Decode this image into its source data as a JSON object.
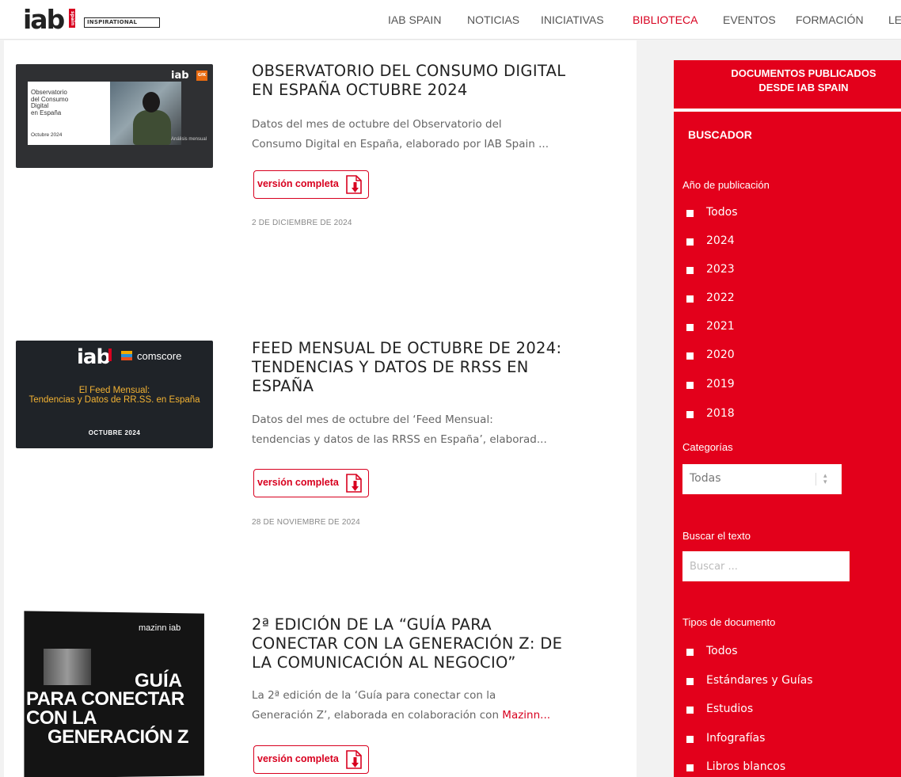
{
  "header": {
    "logo_text": "iab",
    "logo_badge": "INSPIRATIONAL",
    "logo_spain": "spain",
    "nav": [
      {
        "label": "IAB SPAIN",
        "active": false
      },
      {
        "label": "NOTICIAS",
        "active": false
      },
      {
        "label": "INICIATIVAS",
        "active": false
      },
      {
        "label": "BIBLIOTECA",
        "active": true
      },
      {
        "label": "EVENTOS",
        "active": false
      },
      {
        "label": "FORMACIÓN",
        "active": false
      },
      {
        "label": "LE",
        "active": false
      }
    ]
  },
  "articles": [
    {
      "title_lines": [
        "OBSERVATORIO DEL CONSUMO DIGITAL",
        "EN ESPAÑA OCTUBRE 2024"
      ],
      "desc_lines": [
        "Datos del mes de octubre del Observatorio del",
        "Consumo Digital en España, elaborado por IAB Spain ..."
      ],
      "button": "versión completa",
      "date": "2 DE DICIEMBRE DE 2024",
      "thumb": {
        "card_lines": [
          "Observatorio",
          "del Consumo",
          "Digital",
          "en España"
        ],
        "card_date": "Octubre 2024",
        "brand": "iab",
        "partner": "GfK",
        "label": "Análisis mensual"
      }
    },
    {
      "title_lines": [
        "FEED MENSUAL DE OCTUBRE DE 2024:",
        "TENDENCIAS Y DATOS DE RRSS EN",
        "ESPAÑA"
      ],
      "desc_lines": [
        "Datos del mes de octubre del ‘Feed Mensual:",
        "tendencias y datos de las RRSS en España’, elaborad..."
      ],
      "button": "versión completa",
      "date": "28 DE NOVIEMBRE DE 2024",
      "thumb": {
        "brand": "iab",
        "partner": "comscore",
        "text_lines": [
          "El Feed Mensual:",
          "Tendencias y Datos de RR.SS. en España"
        ],
        "month": "OCTUBRE 2024"
      }
    },
    {
      "title_lines": [
        "2ª EDICIÓN DE LA “GUÍA PARA",
        "CONECTAR CON LA GENERACIÓN Z: DE",
        "LA COMUNICACIÓN AL NEGOCIO”"
      ],
      "desc_line1": "La 2ª edición de la ‘Guía para conectar con la",
      "desc_line2_pre": "Generación Z’, elaborada en colaboración con ",
      "desc_line2_link": "Mazinn...",
      "button": "versión completa",
      "thumb": {
        "brand_line": "mazinn iab",
        "guia": "GUÍA",
        "lines": [
          "PARA CONECTAR",
          "CON LA",
          "GENERACIÓN Z"
        ]
      }
    }
  ],
  "sidebar": {
    "header_lines": [
      "DOCUMENTOS PUBLICADOS",
      "DESDE IAB SPAIN"
    ],
    "buscador": "BUSCADOR",
    "year_label": "Año de publicación",
    "years": [
      "Todos",
      "2024",
      "2023",
      "2022",
      "2021",
      "2020",
      "2019",
      "2018"
    ],
    "categories_label": "Categorías",
    "categories_value": "Todas",
    "search_label": "Buscar el texto",
    "search_placeholder": "Buscar ...",
    "doc_types_label": "Tipos de documento",
    "doc_types": [
      "Todos",
      "Estándares y Guías",
      "Estudios",
      "Infografías",
      "Libros blancos"
    ]
  },
  "colors": {
    "brand_red": "#e3001b",
    "accent_red": "#d8001f"
  }
}
